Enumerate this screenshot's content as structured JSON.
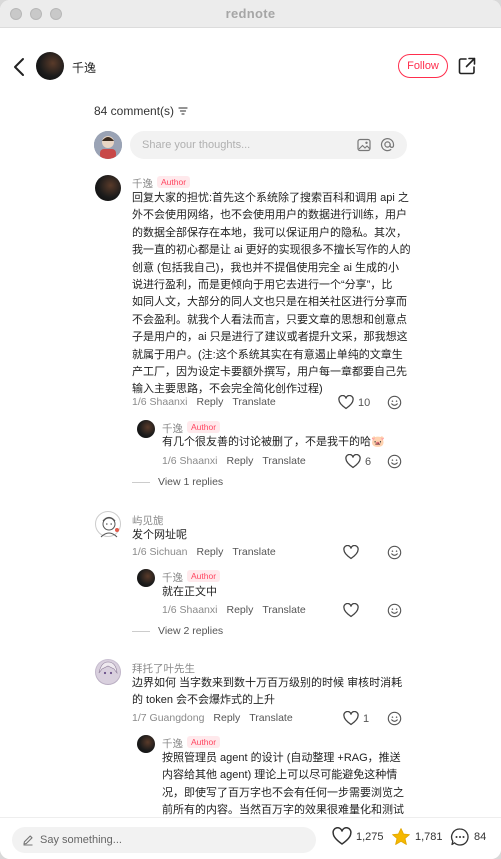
{
  "window": {
    "title": "rednote"
  },
  "header": {
    "author_name": "千逸",
    "follow_label": "Follow"
  },
  "comments_header": {
    "count_label": "84 comment(s)"
  },
  "composer": {
    "placeholder": "Share your thoughts..."
  },
  "comments": [
    {
      "user": "千逸",
      "badge": "Author",
      "lines": [
        "回复大家的担忧:首先这个系统除了搜索百科和调用 api 之",
        "外不会使用网络，也不会使用用户的数据进行训练，用户",
        "的数据全部保存在本地，我可以保证用户的隐私。其次，",
        "我一直的初心都是让 ai 更好的实现很多不擅长写作的人的",
        "创意 (包括我自己)，我也并不提倡使用完全 ai 生成的小",
        "说进行盈利，而是更倾向于用它去进行一个“分享”，比",
        "如同人文，大部分的同人文也只是在相关社区进行分享而",
        "不会盈利。就我个人看法而言，只要文章的思想和创意点",
        "子是用户的，ai 只是进行了建议或者提升文采，那我想这",
        "就属于用户。(注:这个系统其实在有意遏止单纯的文章生",
        "产工厂，因为设定卡要额外撰写，用户每一章都要自己先",
        "输入主要思路，不会完全简化创作过程)"
      ],
      "date": "1/6",
      "location": "Shaanxi",
      "reply_label": "Reply",
      "translate_label": "Translate",
      "likes": "10",
      "reply": {
        "user": "千逸",
        "badge": "Author",
        "text": "有几个很友善的讨论被删了，不是我干的哈🐷",
        "date": "1/6",
        "location": "Shaanxi",
        "reply_label": "Reply",
        "translate_label": "Translate",
        "likes": "6"
      },
      "view_more": "View 1 replies"
    },
    {
      "user": "屿见旎",
      "text": "发个网址呢",
      "date": "1/6",
      "location": "Sichuan",
      "reply_label": "Reply",
      "translate_label": "Translate",
      "reply": {
        "user": "千逸",
        "badge": "Author",
        "text": "就在正文中",
        "date": "1/6",
        "location": "Shaanxi",
        "reply_label": "Reply",
        "translate_label": "Translate"
      },
      "view_more": "View 2 replies"
    },
    {
      "user": "拜托了叶先生",
      "lines": [
        "边界如何 当字数来到数十万百万级别的时候 审核时消耗",
        "的 token 会不会爆炸式的上升"
      ],
      "date": "1/7",
      "location": "Guangdong",
      "reply_label": "Reply",
      "translate_label": "Translate",
      "likes": "1",
      "reply": {
        "user": "千逸",
        "badge": "Author",
        "lines": [
          "按照管理员 agent 的设计 (自动整理 +RAG，推送",
          "内容给其他 agent) 理论上可以尽可能避免这种情",
          "况，即使写了百万字也不会有任何一步需要浏览之",
          "前所有的内容。当然百万字的效果很难量化和测试"
        ]
      }
    }
  ],
  "bottom_bar": {
    "say_placeholder": "Say something...",
    "likes": "1,275",
    "collects": "1,781",
    "comments": "84"
  },
  "colors": {
    "accent": "#ff2e4d",
    "star": "#f5b800"
  },
  "icons": [
    "back-arrow-icon",
    "share-icon",
    "sort-icon",
    "image-icon",
    "at-icon",
    "heart-icon",
    "emoji-icon",
    "pencil-icon",
    "star-icon",
    "comment-bubble-icon"
  ]
}
